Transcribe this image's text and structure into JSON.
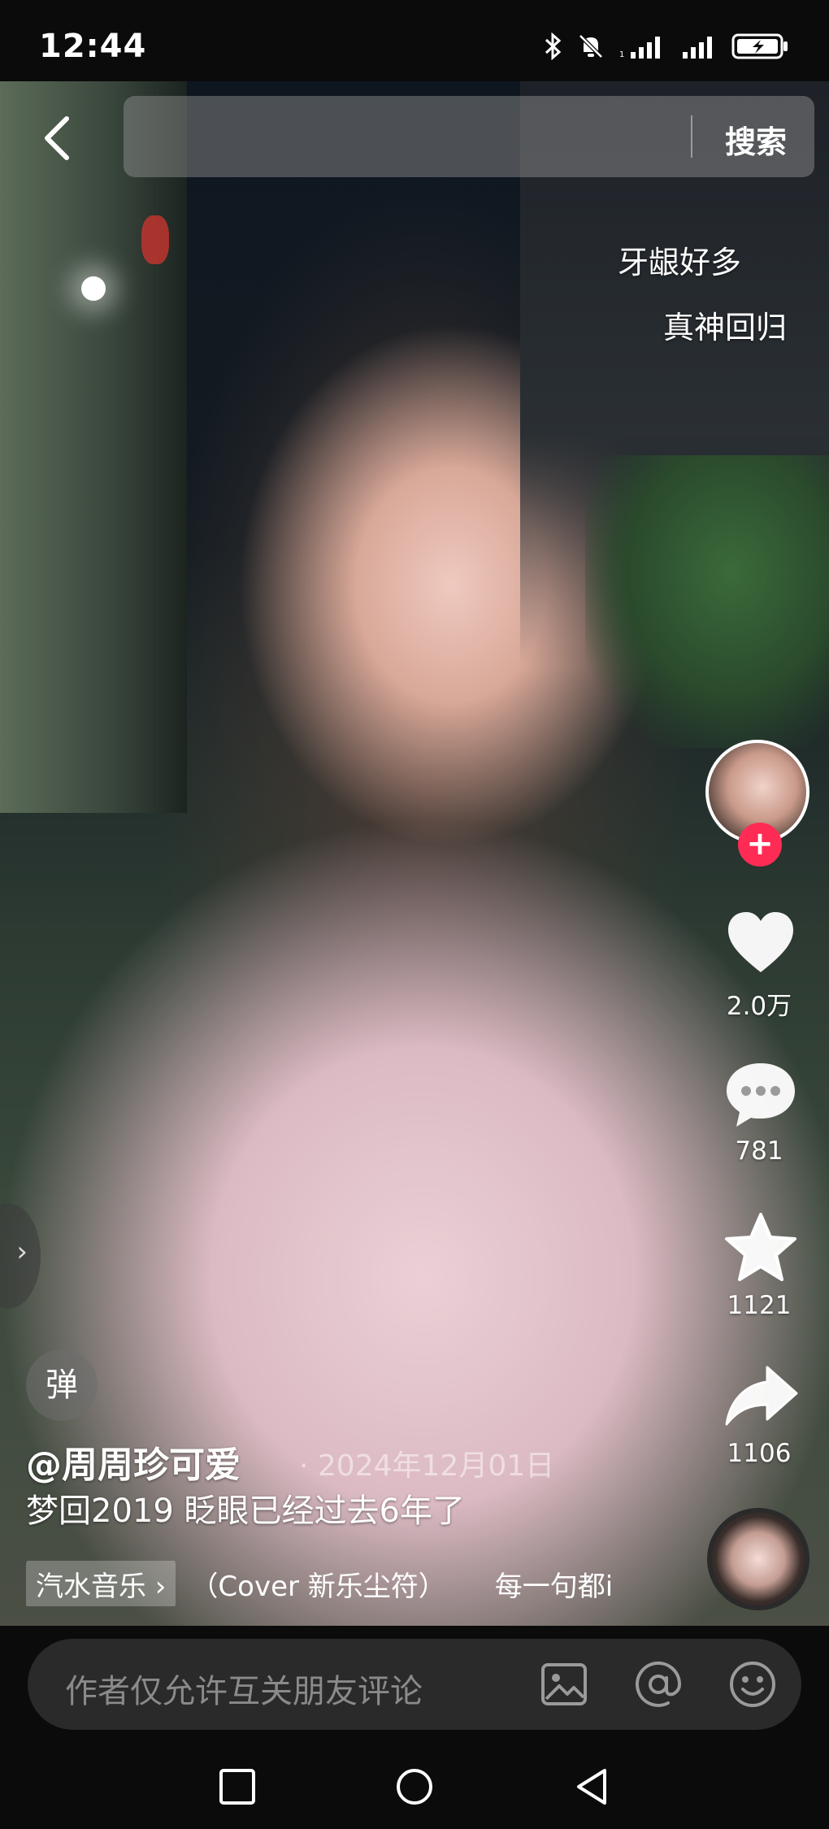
{
  "status_bar": {
    "time": "12:44"
  },
  "search": {
    "button_label": "搜索"
  },
  "danmaku": [
    "牙龈好多",
    "真神回归"
  ],
  "actions": {
    "likes": "2.0万",
    "comments": "781",
    "favorites": "1121",
    "shares": "1106"
  },
  "side_tab": {
    "arrow": "›"
  },
  "bullet_button": {
    "label": "弹"
  },
  "post": {
    "author": "@周周珍可爱",
    "date": "· 2024年12月01日",
    "description": "梦回2019 眨眼已经过去6年了"
  },
  "music": {
    "tag": "汽水音乐 ›",
    "title": "（Cover 新乐尘符）",
    "lyric": "每一句都i"
  },
  "comment_bar": {
    "placeholder": "作者仅允许互关朋友评论"
  },
  "colors": {
    "accent": "#fe2c55",
    "bar_bg": "#2a2a2a"
  }
}
